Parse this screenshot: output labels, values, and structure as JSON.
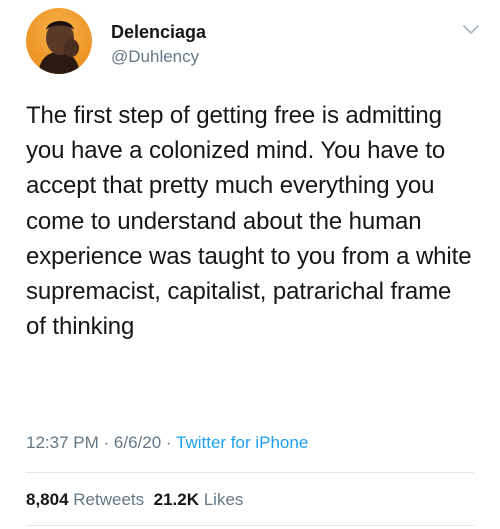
{
  "author": {
    "display_name": "Delenciaga",
    "handle": "@Duhlency",
    "avatar_icon": "profile-photo"
  },
  "tweet": {
    "text": "The first step of getting free is admitting you have a colonized mind. You have to accept that pretty much everything you come to understand about the human experience was taught to you from a white supremacist, capitalist, patrarichal frame of thinking",
    "time": "12:37 PM",
    "separator": "·",
    "date": "6/6/20",
    "source": "Twitter for iPhone"
  },
  "stats": {
    "retweets_count": "8,804",
    "retweets_label": "Retweets",
    "likes_count": "21.2K",
    "likes_label": "Likes"
  },
  "colors": {
    "link": "#1da1f2",
    "muted": "#657786",
    "text": "#14171a"
  }
}
